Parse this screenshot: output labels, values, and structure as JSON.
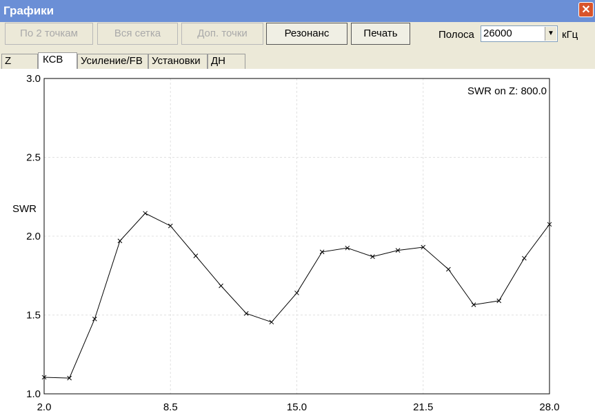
{
  "window": {
    "title": "Графики"
  },
  "toolbar": {
    "buttons": [
      {
        "label": "По 2 точкам",
        "enabled": false
      },
      {
        "label": "Вся сетка",
        "enabled": false
      },
      {
        "label": "Доп. точки",
        "enabled": false
      },
      {
        "label": "Резонанс",
        "enabled": true
      },
      {
        "label": "Печать",
        "enabled": true
      }
    ],
    "band_label": "Полоса",
    "band_value": "26000",
    "band_unit": "кГц"
  },
  "tabs": [
    {
      "label": "Z",
      "selected": false
    },
    {
      "label": "КСВ",
      "selected": true
    },
    {
      "label": "Усиление/FB",
      "selected": false
    },
    {
      "label": "Установки",
      "selected": false
    },
    {
      "label": "ДН",
      "selected": false
    }
  ],
  "chart_data": {
    "type": "line",
    "ylabel": "SWR",
    "annotation": "SWR on Z: 800.0",
    "xlim": [
      2.0,
      28.0
    ],
    "ylim": [
      1.0,
      3.0
    ],
    "xticks": [
      "2.0",
      "8.5",
      "15.0",
      "21.5",
      "28.0"
    ],
    "yticks": [
      "1.0",
      "1.5",
      "2.0",
      "2.5",
      "3.0"
    ],
    "grid": true,
    "x": [
      2.0,
      3.3,
      4.6,
      5.9,
      7.2,
      8.5,
      9.8,
      11.1,
      12.4,
      13.7,
      15.0,
      16.3,
      17.6,
      18.9,
      20.2,
      21.5,
      22.8,
      24.1,
      25.4,
      26.7,
      28.0
    ],
    "y": [
      1.105,
      1.1,
      1.475,
      1.97,
      2.145,
      2.065,
      1.875,
      1.685,
      1.51,
      1.455,
      1.64,
      1.9,
      1.925,
      1.87,
      1.91,
      1.93,
      1.79,
      1.565,
      1.59,
      1.86,
      2.075
    ],
    "series_color": "#000000",
    "grid_color": "#e0e0e0"
  }
}
